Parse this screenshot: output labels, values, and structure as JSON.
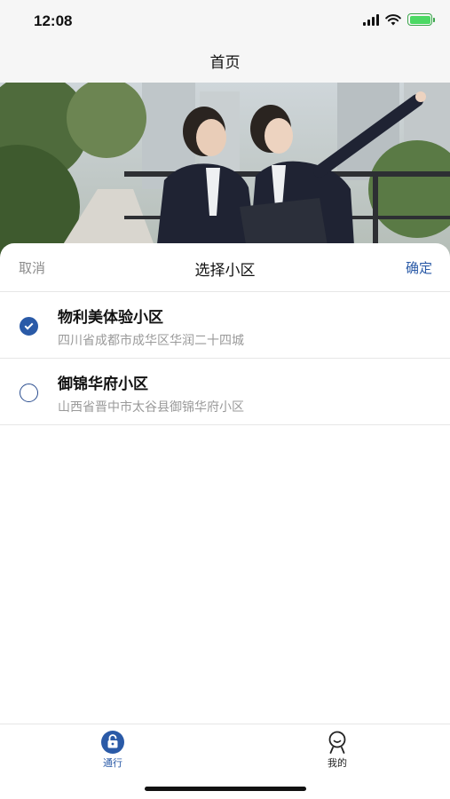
{
  "status_bar": {
    "time": "12:08",
    "icons": [
      "signal-icon",
      "wifi-icon",
      "battery-charging-icon"
    ]
  },
  "nav": {
    "title": "首页"
  },
  "sheet": {
    "cancel_label": "取消",
    "title": "选择小区",
    "confirm_label": "确定",
    "communities": [
      {
        "name": "物利美体验小区",
        "address": "四川省成都市成华区华润二十四城",
        "selected": true
      },
      {
        "name": "御锦华府小区",
        "address": "山西省晋中市太谷县御锦华府小区",
        "selected": false
      }
    ]
  },
  "tab_bar": {
    "tabs": [
      {
        "label": "通行",
        "icon": "unlock-icon",
        "active": true
      },
      {
        "label": "我的",
        "icon": "user-icon",
        "active": false
      }
    ]
  },
  "colors": {
    "accent": "#2a5aa7",
    "muted_text": "#9a9a9a",
    "divider": "#e6e6e6"
  }
}
